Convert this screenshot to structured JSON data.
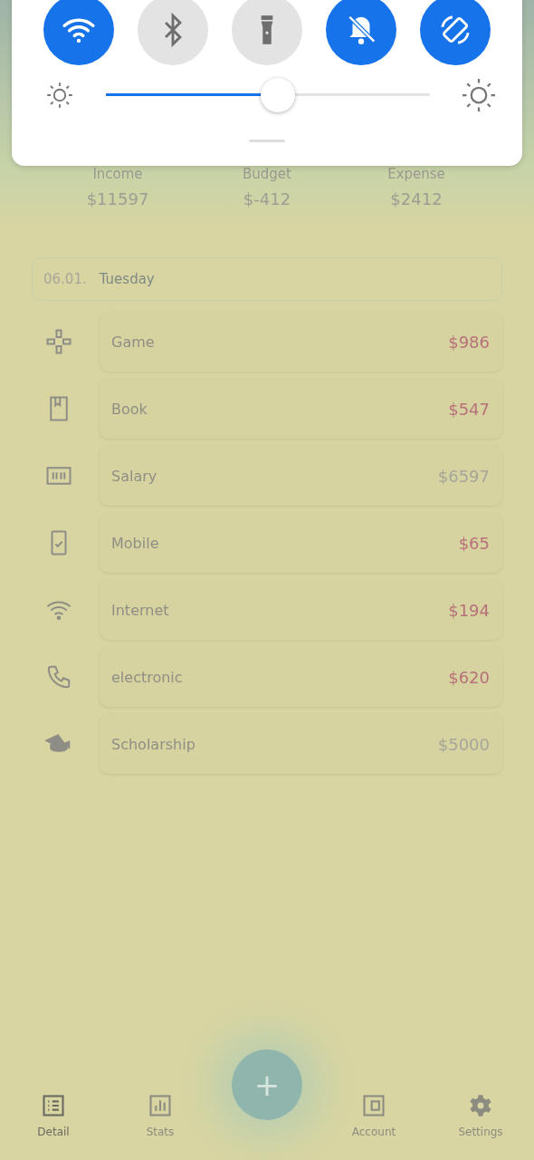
{
  "quick_panel": {
    "toggles": [
      {
        "kind": "wifi",
        "on": true
      },
      {
        "kind": "bluetooth",
        "on": false
      },
      {
        "kind": "flashlight",
        "on": false
      },
      {
        "kind": "mute",
        "on": true
      },
      {
        "kind": "rotate",
        "on": true
      }
    ],
    "brightness": {
      "level": 0.53
    }
  },
  "summary": [
    {
      "label": "Income",
      "amount": "$11597"
    },
    {
      "label": "Budget",
      "amount": "$-412"
    },
    {
      "label": "Expense",
      "amount": "$2412"
    }
  ],
  "date_header": {
    "date": "06.01.",
    "weekday": "Tuesday"
  },
  "transactions": [
    {
      "name": "Game",
      "amount": "$986",
      "kind": "expense"
    },
    {
      "name": "Book",
      "amount": "$547",
      "kind": "expense"
    },
    {
      "name": "Salary",
      "amount": "$6597",
      "kind": "income"
    },
    {
      "name": "Mobile",
      "amount": "$65",
      "kind": "expense"
    },
    {
      "name": "Internet",
      "amount": "$194",
      "kind": "expense"
    },
    {
      "name": "electronic",
      "amount": "$620",
      "kind": "expense"
    },
    {
      "name": "Scholarship",
      "amount": "$5000",
      "kind": "income"
    }
  ],
  "add_button": {
    "label": "+"
  },
  "nav": [
    {
      "label": "Detail",
      "selected": true
    },
    {
      "label": "Stats",
      "selected": false
    },
    {
      "label": "Account",
      "selected": false
    },
    {
      "label": "Settings",
      "selected": false
    }
  ]
}
